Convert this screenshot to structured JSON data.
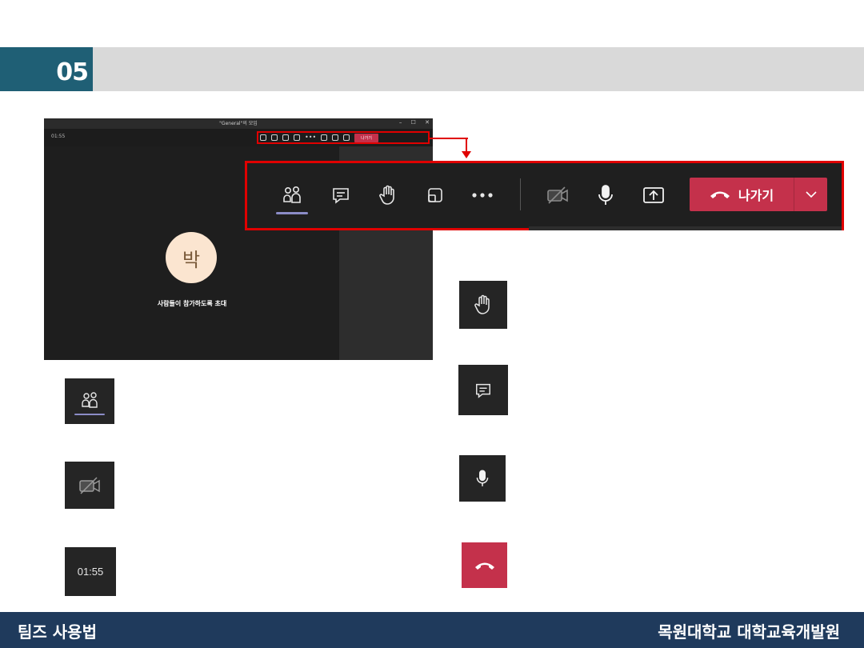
{
  "header": {
    "section_number": "05"
  },
  "window": {
    "title": "\"General\"의 모임",
    "controls": [
      "–",
      "☐",
      "✕"
    ],
    "elapsed": "01:55",
    "mini_leave_label": "나가기",
    "avatar_initial": "박",
    "invite_text": "사람들이 참가하도록 초대"
  },
  "toolbar": {
    "leave_label": "나가기",
    "icons": [
      "participants-icon",
      "chat-icon",
      "raise-hand-icon",
      "share-tray-icon",
      "more-icon",
      "camera-off-icon",
      "mic-icon",
      "share-screen-icon",
      "hang-up-icon",
      "chevron-down-icon"
    ],
    "accent": "#8b8cc7",
    "leave_color": "#c4314b"
  },
  "tiles": {
    "time_text": "01:55"
  },
  "footer": {
    "left": "팀즈 사용법",
    "right": "목원대학교 대학교육개발원"
  }
}
